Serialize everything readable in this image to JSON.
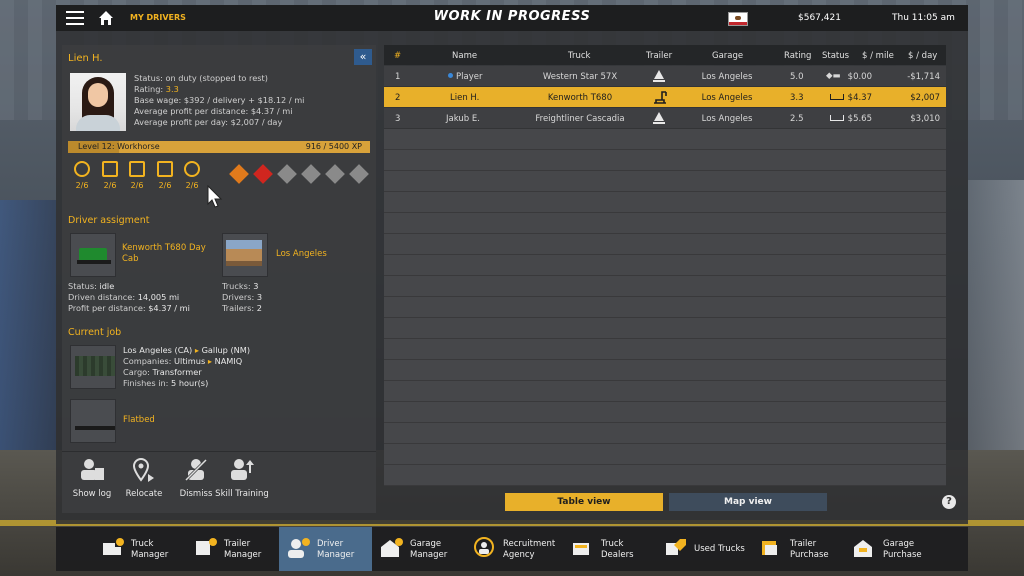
{
  "topbar": {
    "crumb": "MY DRIVERS",
    "title": "WORK IN PROGRESS",
    "money": "$567,421",
    "clock": "Thu 11:05 am"
  },
  "driver": {
    "name": "Lien H.",
    "status_label": "Status: ",
    "status": "on duty (stopped to rest)",
    "rating_label": "Rating: ",
    "rating": "3.3",
    "wage": "Base wage: $392 / delivery + $18.12 / mi",
    "profit_dist": "Average profit per distance: $4.37 / mi",
    "profit_day": "Average profit per day: $2,007 / day",
    "level": "Level 12: Workhorse",
    "xp": "916 / 5400 XP",
    "xp_fraction": 0.17,
    "skills": [
      {
        "icon": "long-distance-icon",
        "value": "2/6"
      },
      {
        "icon": "high-value-cargo-icon",
        "value": "2/6"
      },
      {
        "icon": "fragile-cargo-icon",
        "value": "2/6"
      },
      {
        "icon": "just-in-time-icon",
        "value": "2/6"
      },
      {
        "icon": "ecodriving-icon",
        "value": "2/6"
      }
    ],
    "adr": [
      {
        "icon": "adr-explosives-icon",
        "color": "#e07a1c"
      },
      {
        "icon": "adr-gas-icon",
        "color": "#d0261f"
      },
      {
        "icon": "adr-flammable-icon",
        "color": "#8a8a8a"
      },
      {
        "icon": "adr-toxic-icon",
        "color": "#8a8a8a"
      },
      {
        "icon": "adr-radioactive-icon",
        "color": "#8a8a8a"
      },
      {
        "icon": "adr-corrosive-icon",
        "color": "#8a8a8a"
      }
    ]
  },
  "assignment": {
    "heading": "Driver assigment",
    "truck": "Kenworth T680 Day Cab",
    "garage": "Los Angeles",
    "status_label": "Status: ",
    "status": "idle",
    "driven_label": "Driven distance: ",
    "driven": "14,005 mi",
    "ppd_label": "Profit per distance: ",
    "ppd": "$4.37 / mi",
    "trucks_label": "Trucks: ",
    "trucks": "3",
    "drivers_label": "Drivers: ",
    "drivers": "3",
    "trailers_label": "Trailers: ",
    "trailers": "2"
  },
  "job": {
    "heading": "Current job",
    "from": "Los Angeles (CA)",
    "to": "Gallup (NM)",
    "companies_label": "Companies: ",
    "company_from": "Ultimus",
    "company_to": "NAMIQ",
    "cargo_label": "Cargo: ",
    "cargo": "Transformer",
    "finish_label": "Finishes in: ",
    "finish": "5 hour(s)",
    "trailer": "Flatbed"
  },
  "actions": [
    {
      "label": "Show log",
      "icon": "show-log-icon"
    },
    {
      "label": "Relocate",
      "icon": "relocate-icon"
    },
    {
      "label": "Dismiss",
      "icon": "dismiss-icon"
    },
    {
      "label": "Skill Training",
      "icon": "skill-training-icon"
    }
  ],
  "table": {
    "headers": {
      "num": "#",
      "name": "Name",
      "truck": "Truck",
      "trailer": "Trailer",
      "garage": "Garage",
      "rating": "Rating",
      "status": "Status",
      "per_mile": "$ / mile",
      "per_day": "$ / day"
    },
    "rows": [
      {
        "num": "1",
        "name": "Player",
        "truck": "Western Star 57X",
        "garage": "Los Angeles",
        "rating": "5.0",
        "per_mile": "$0.00",
        "per_day": "-$1,714"
      },
      {
        "num": "2",
        "name": "Lien H.",
        "truck": "Kenworth T680",
        "garage": "Los Angeles",
        "rating": "3.3",
        "per_mile": "$4.37",
        "per_day": "$2,007"
      },
      {
        "num": "3",
        "name": "Jakub E.",
        "truck": "Freightliner Cascadia",
        "garage": "Los Angeles",
        "rating": "2.5",
        "per_mile": "$5.65",
        "per_day": "$3,010"
      }
    ]
  },
  "views": {
    "table": "Table view",
    "map": "Map view",
    "help": "?"
  },
  "bottom": [
    {
      "l1": "Truck",
      "l2": "Manager",
      "icon": "truck-manager-icon"
    },
    {
      "l1": "Trailer",
      "l2": "Manager",
      "icon": "trailer-manager-icon"
    },
    {
      "l1": "Driver",
      "l2": "Manager",
      "icon": "driver-manager-icon"
    },
    {
      "l1": "Garage",
      "l2": "Manager",
      "icon": "garage-manager-icon"
    },
    {
      "l1": "Recruitment",
      "l2": "Agency",
      "icon": "recruitment-agency-icon"
    },
    {
      "l1": "Truck",
      "l2": "Dealers",
      "icon": "truck-dealers-icon"
    },
    {
      "l1": "Used Trucks",
      "l2": "",
      "icon": "used-trucks-icon"
    },
    {
      "l1": "Trailer",
      "l2": "Purchase",
      "icon": "trailer-purchase-icon"
    },
    {
      "l1": "Garage",
      "l2": "Purchase",
      "icon": "garage-purchase-icon"
    }
  ],
  "colors": {
    "accent": "#f2b320",
    "selected_row": "#e8b02a",
    "active_tab": "#4a6b8c"
  }
}
